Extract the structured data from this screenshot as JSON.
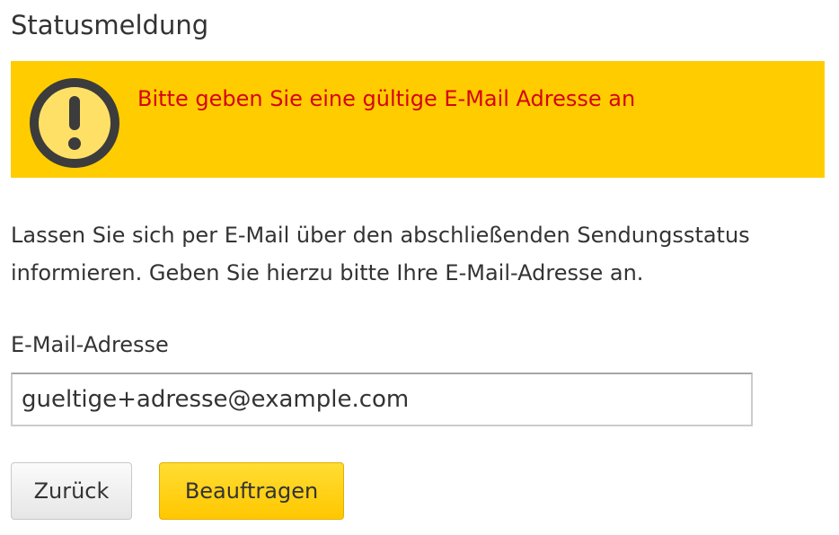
{
  "page": {
    "title": "Statusmeldung"
  },
  "alert": {
    "icon": "warning-exclamation-icon",
    "message": "Bitte geben Sie eine gültige E-Mail Adresse an",
    "background_color": "#ffcc00",
    "text_color": "#d40511"
  },
  "intro": {
    "line1": "Lassen Sie sich per E-Mail über den abschließenden Sendungsstatus",
    "line2": "informieren. Geben Sie hierzu bitte Ihre E-Mail-Adresse an."
  },
  "form": {
    "email_label": "E-Mail-Adresse",
    "email_value": "gueltige+adresse@example.com"
  },
  "buttons": {
    "back_label": "Zurück",
    "submit_label": "Beauftragen",
    "submit_color": "#ffcc00"
  }
}
